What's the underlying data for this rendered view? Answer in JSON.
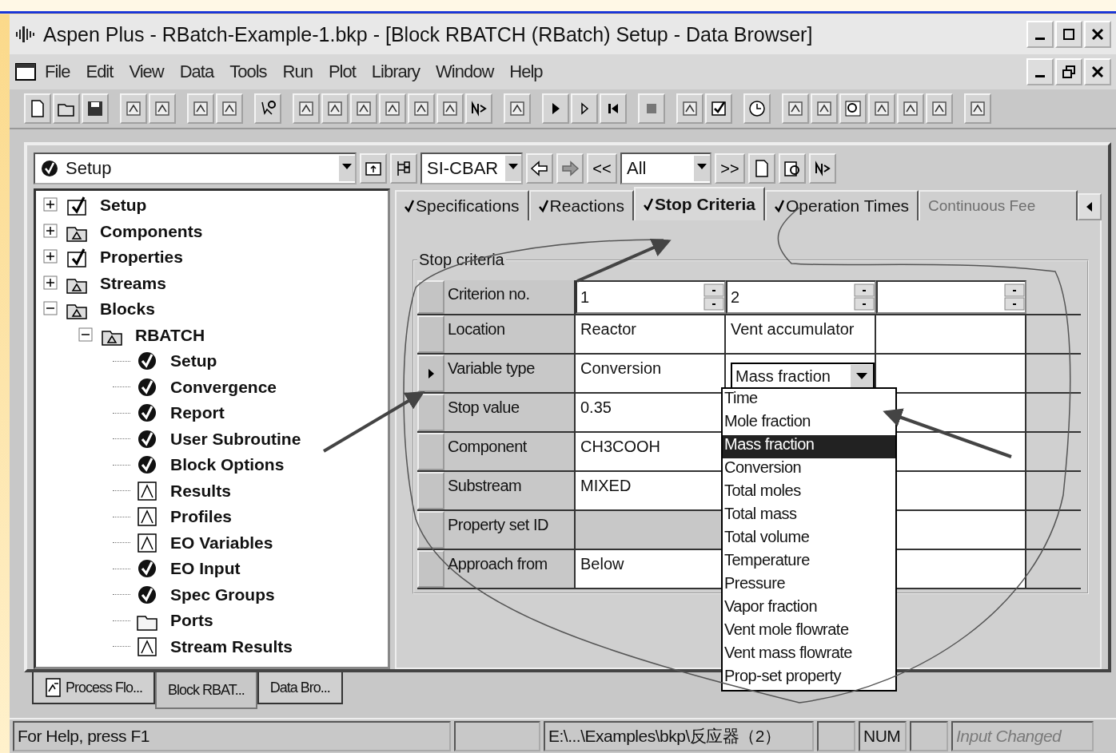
{
  "window": {
    "title": "Aspen Plus - RBatch-Example-1.bkp - [Block RBATCH (RBatch) Setup - Data Browser]"
  },
  "menu": [
    {
      "label": "File"
    },
    {
      "label": "Edit"
    },
    {
      "label": "View"
    },
    {
      "label": "Data"
    },
    {
      "label": "Tools"
    },
    {
      "label": "Run"
    },
    {
      "label": "Plot"
    },
    {
      "label": "Library"
    },
    {
      "label": "Window"
    },
    {
      "label": "Help"
    }
  ],
  "browser": {
    "selector": "Setup",
    "units": "SI-CBAR",
    "prev_button": "<<",
    "filter": "All",
    "next_button": ">>"
  },
  "tree": [
    {
      "label": "Setup",
      "kind": "form",
      "expanded": false
    },
    {
      "label": "Components",
      "kind": "folder",
      "expanded": false
    },
    {
      "label": "Properties",
      "kind": "form",
      "expanded": false
    },
    {
      "label": "Streams",
      "kind": "folder",
      "expanded": false
    },
    {
      "label": "Blocks",
      "kind": "folder",
      "expanded": true,
      "children": [
        {
          "label": "RBATCH",
          "kind": "folder",
          "expanded": true,
          "children": [
            {
              "label": "Setup",
              "kind": "done"
            },
            {
              "label": "Convergence",
              "kind": "done"
            },
            {
              "label": "Report",
              "kind": "done"
            },
            {
              "label": "User Subroutine",
              "kind": "done"
            },
            {
              "label": "Block Options",
              "kind": "done"
            },
            {
              "label": "Results",
              "kind": "results"
            },
            {
              "label": "Profiles",
              "kind": "results"
            },
            {
              "label": "EO Variables",
              "kind": "results"
            },
            {
              "label": "EO Input",
              "kind": "done"
            },
            {
              "label": "Spec Groups",
              "kind": "done"
            },
            {
              "label": "Ports",
              "kind": "empty"
            },
            {
              "label": "Stream Results",
              "kind": "results"
            }
          ]
        }
      ]
    }
  ],
  "tabs": [
    {
      "label": "Specifications",
      "checked": true,
      "selected": false,
      "disabled": false
    },
    {
      "label": "Reactions",
      "checked": true,
      "selected": false,
      "disabled": false
    },
    {
      "label": "Stop Criteria",
      "checked": true,
      "selected": true,
      "disabled": false
    },
    {
      "label": "Operation Times",
      "checked": true,
      "selected": false,
      "disabled": false
    },
    {
      "label": "Continuous Fee",
      "checked": false,
      "selected": false,
      "disabled": true
    }
  ],
  "group": {
    "title": "Stop criteria"
  },
  "grid": {
    "header": {
      "label": "Criterion no.",
      "values": [
        "1",
        "2"
      ]
    },
    "rows": [
      {
        "label": "Location",
        "current": false,
        "disabled": false,
        "values": [
          "Reactor",
          "Vent accumulator"
        ]
      },
      {
        "label": "Variable type",
        "current": true,
        "disabled": false,
        "values": [
          "Conversion"
        ],
        "select": {
          "value": "Mass fraction"
        }
      },
      {
        "label": "Stop value",
        "current": false,
        "disabled": false,
        "values": [
          "0.35"
        ]
      },
      {
        "label": "Component",
        "current": false,
        "disabled": false,
        "values": [
          "CH3COOH"
        ]
      },
      {
        "label": "Substream",
        "current": false,
        "disabled": false,
        "values": [
          "MIXED"
        ]
      },
      {
        "label": "Property set ID",
        "current": false,
        "disabled": true,
        "values": []
      },
      {
        "label": "Approach from",
        "current": false,
        "disabled": false,
        "values": [
          "Below"
        ]
      }
    ]
  },
  "dropdown": {
    "options": [
      {
        "label": "Time",
        "selected": false
      },
      {
        "label": "Mole fraction",
        "selected": false
      },
      {
        "label": "Mass fraction",
        "selected": true
      },
      {
        "label": "Conversion",
        "selected": false
      },
      {
        "label": "Total moles",
        "selected": false
      },
      {
        "label": "Total mass",
        "selected": false
      },
      {
        "label": "Total volume",
        "selected": false
      },
      {
        "label": "Temperature",
        "selected": false
      },
      {
        "label": "Pressure",
        "selected": false
      },
      {
        "label": "Vapor fraction",
        "selected": false
      },
      {
        "label": "Vent mole flowrate",
        "selected": false
      },
      {
        "label": "Vent mass flowrate",
        "selected": false
      },
      {
        "label": "Prop-set property",
        "selected": false
      }
    ]
  },
  "window_tabs": [
    {
      "label": "Process Flo...",
      "selected": false,
      "kind": "flowsheet"
    },
    {
      "label": "Block RBAT...",
      "selected": true,
      "kind": "form"
    },
    {
      "label": "Data Bro...",
      "selected": false,
      "kind": "form"
    }
  ],
  "status_bar": [
    {
      "text": "For Help, press F1",
      "disabled": false
    },
    {
      "text": "E:\\...\\Examples\\bkp\\反应器（2）",
      "disabled": false
    },
    {
      "text": "NUM",
      "disabled": false
    },
    {
      "text": "Input Changed",
      "disabled": true
    }
  ]
}
